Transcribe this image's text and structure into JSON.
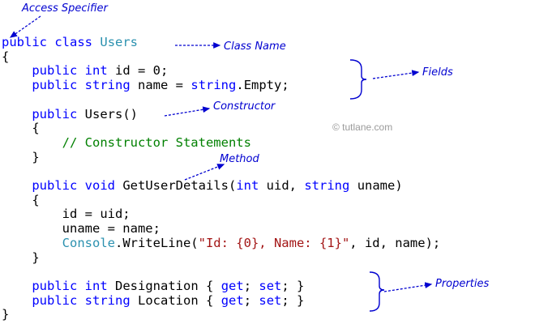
{
  "code": {
    "line1": {
      "kw1": "public",
      "kw2": "class",
      "cls": "Users"
    },
    "line2": {
      "brace": "{"
    },
    "line3": {
      "kw1": "public",
      "kw2": "int",
      "rest": "id = 0;"
    },
    "line4": {
      "kw1": "public",
      "kw2": "string",
      "rest1": "name =",
      "kw3": "string",
      "rest2": ".Empty;"
    },
    "line6": {
      "kw1": "public",
      "rest": "Users()"
    },
    "line7": {
      "brace": "{"
    },
    "line8": {
      "comment": "// Constructor Statements"
    },
    "line9": {
      "brace": "}"
    },
    "line11": {
      "kw1": "public",
      "kw2": "void",
      "rest1": "GetUserDetails(",
      "kw3": "int",
      "rest2": "uid,",
      "kw4": "string",
      "rest3": "uname)"
    },
    "line12": {
      "brace": "{"
    },
    "line13": {
      "text": "id = uid;"
    },
    "line14": {
      "text": "uname = name;"
    },
    "line15": {
      "cls": "Console",
      "rest1": ".WriteLine(",
      "str": "\"Id: {0}, Name: {1}\"",
      "rest2": ", id, name);"
    },
    "line16": {
      "brace": "}"
    },
    "line18": {
      "kw1": "public",
      "kw2": "int",
      "rest1": "Designation {",
      "kw3": "get",
      "sep": ";",
      "kw4": "set",
      "rest2": "; }"
    },
    "line19": {
      "kw1": "public",
      "kw2": "string",
      "rest1": "Location {",
      "kw3": "get",
      "sep": ";",
      "kw4": "set",
      "rest2": "; }"
    },
    "line20": {
      "brace": "}"
    }
  },
  "annotations": {
    "access_specifier": "Access Specifier",
    "class_name": "Class Name",
    "fields": "Fields",
    "constructor": "Constructor",
    "method": "Method",
    "properties": "Properties"
  },
  "watermark": "© tutlane.com",
  "colors": {
    "keyword": "#0000ff",
    "type": "#2b91af",
    "string": "#a31515",
    "comment": "#008000",
    "annotation": "#0000d0"
  }
}
